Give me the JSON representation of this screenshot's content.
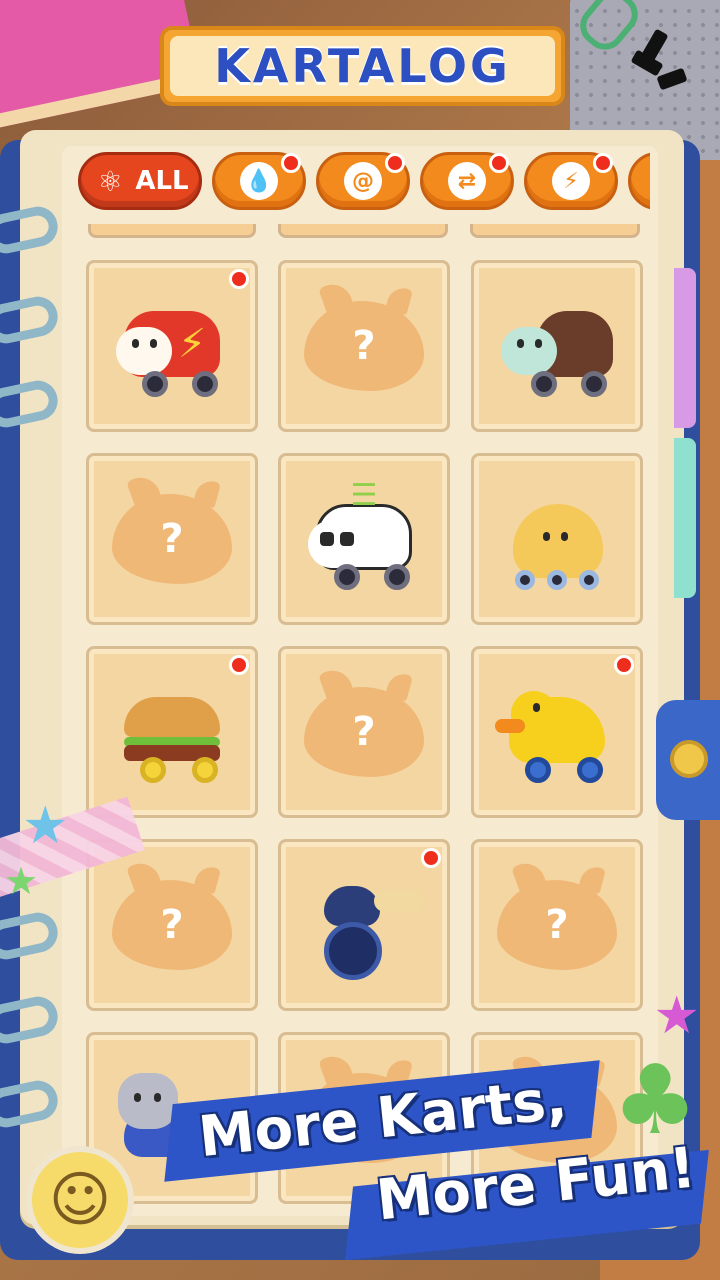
{
  "header": {
    "title": "KARTALOG"
  },
  "filters": [
    {
      "label": "ALL",
      "icon": "creature-icon",
      "active": true,
      "badge": false
    },
    {
      "label": "",
      "icon": "drop-icon",
      "active": false,
      "badge": true
    },
    {
      "label": "",
      "icon": "snail-shell-icon",
      "active": false,
      "badge": true
    },
    {
      "label": "",
      "icon": "swap-arrows-icon",
      "active": false,
      "badge": true
    },
    {
      "label": "",
      "icon": "lightning-icon",
      "active": false,
      "badge": true
    },
    {
      "label": "",
      "icon": "more-category-icon",
      "active": false,
      "badge": false
    }
  ],
  "grid": {
    "cells": [
      {
        "kart": "dog-rocket-kart",
        "locked": false,
        "new": true
      },
      {
        "kart": "unknown",
        "locked": true,
        "placeholder": "?",
        "new": false
      },
      {
        "kart": "squirrel-chocolate-kart",
        "locked": false,
        "new": false
      },
      {
        "kart": "unknown",
        "locked": true,
        "placeholder": "?",
        "new": false
      },
      {
        "kart": "panda-bamboo-kart",
        "locked": false,
        "new": false
      },
      {
        "kart": "octopus-kart",
        "locked": false,
        "new": false
      },
      {
        "kart": "burger-kart",
        "locked": false,
        "new": true
      },
      {
        "kart": "unknown",
        "locked": true,
        "placeholder": "?",
        "new": false
      },
      {
        "kart": "rubber-duck-kart",
        "locked": false,
        "new": true
      },
      {
        "kart": "unknown",
        "locked": true,
        "placeholder": "?",
        "new": false
      },
      {
        "kart": "bee-unicycle-kart",
        "locked": false,
        "new": true
      },
      {
        "kart": "unknown",
        "locked": true,
        "placeholder": "?",
        "new": false
      },
      {
        "kart": "cat-kart",
        "locked": false,
        "new": false
      },
      {
        "kart": "unknown",
        "locked": true,
        "placeholder": "",
        "new": false
      },
      {
        "kart": "unknown",
        "locked": true,
        "placeholder": "",
        "new": false
      }
    ]
  },
  "banner": {
    "line1": "More Karts,",
    "line2": "More Fun!"
  },
  "colors": {
    "accent_orange": "#f28a1e",
    "active_red": "#e6461e",
    "title_blue": "#2c4fc2",
    "badge_red": "#ef2d1d",
    "cell_bg": "#f4d6a2"
  }
}
